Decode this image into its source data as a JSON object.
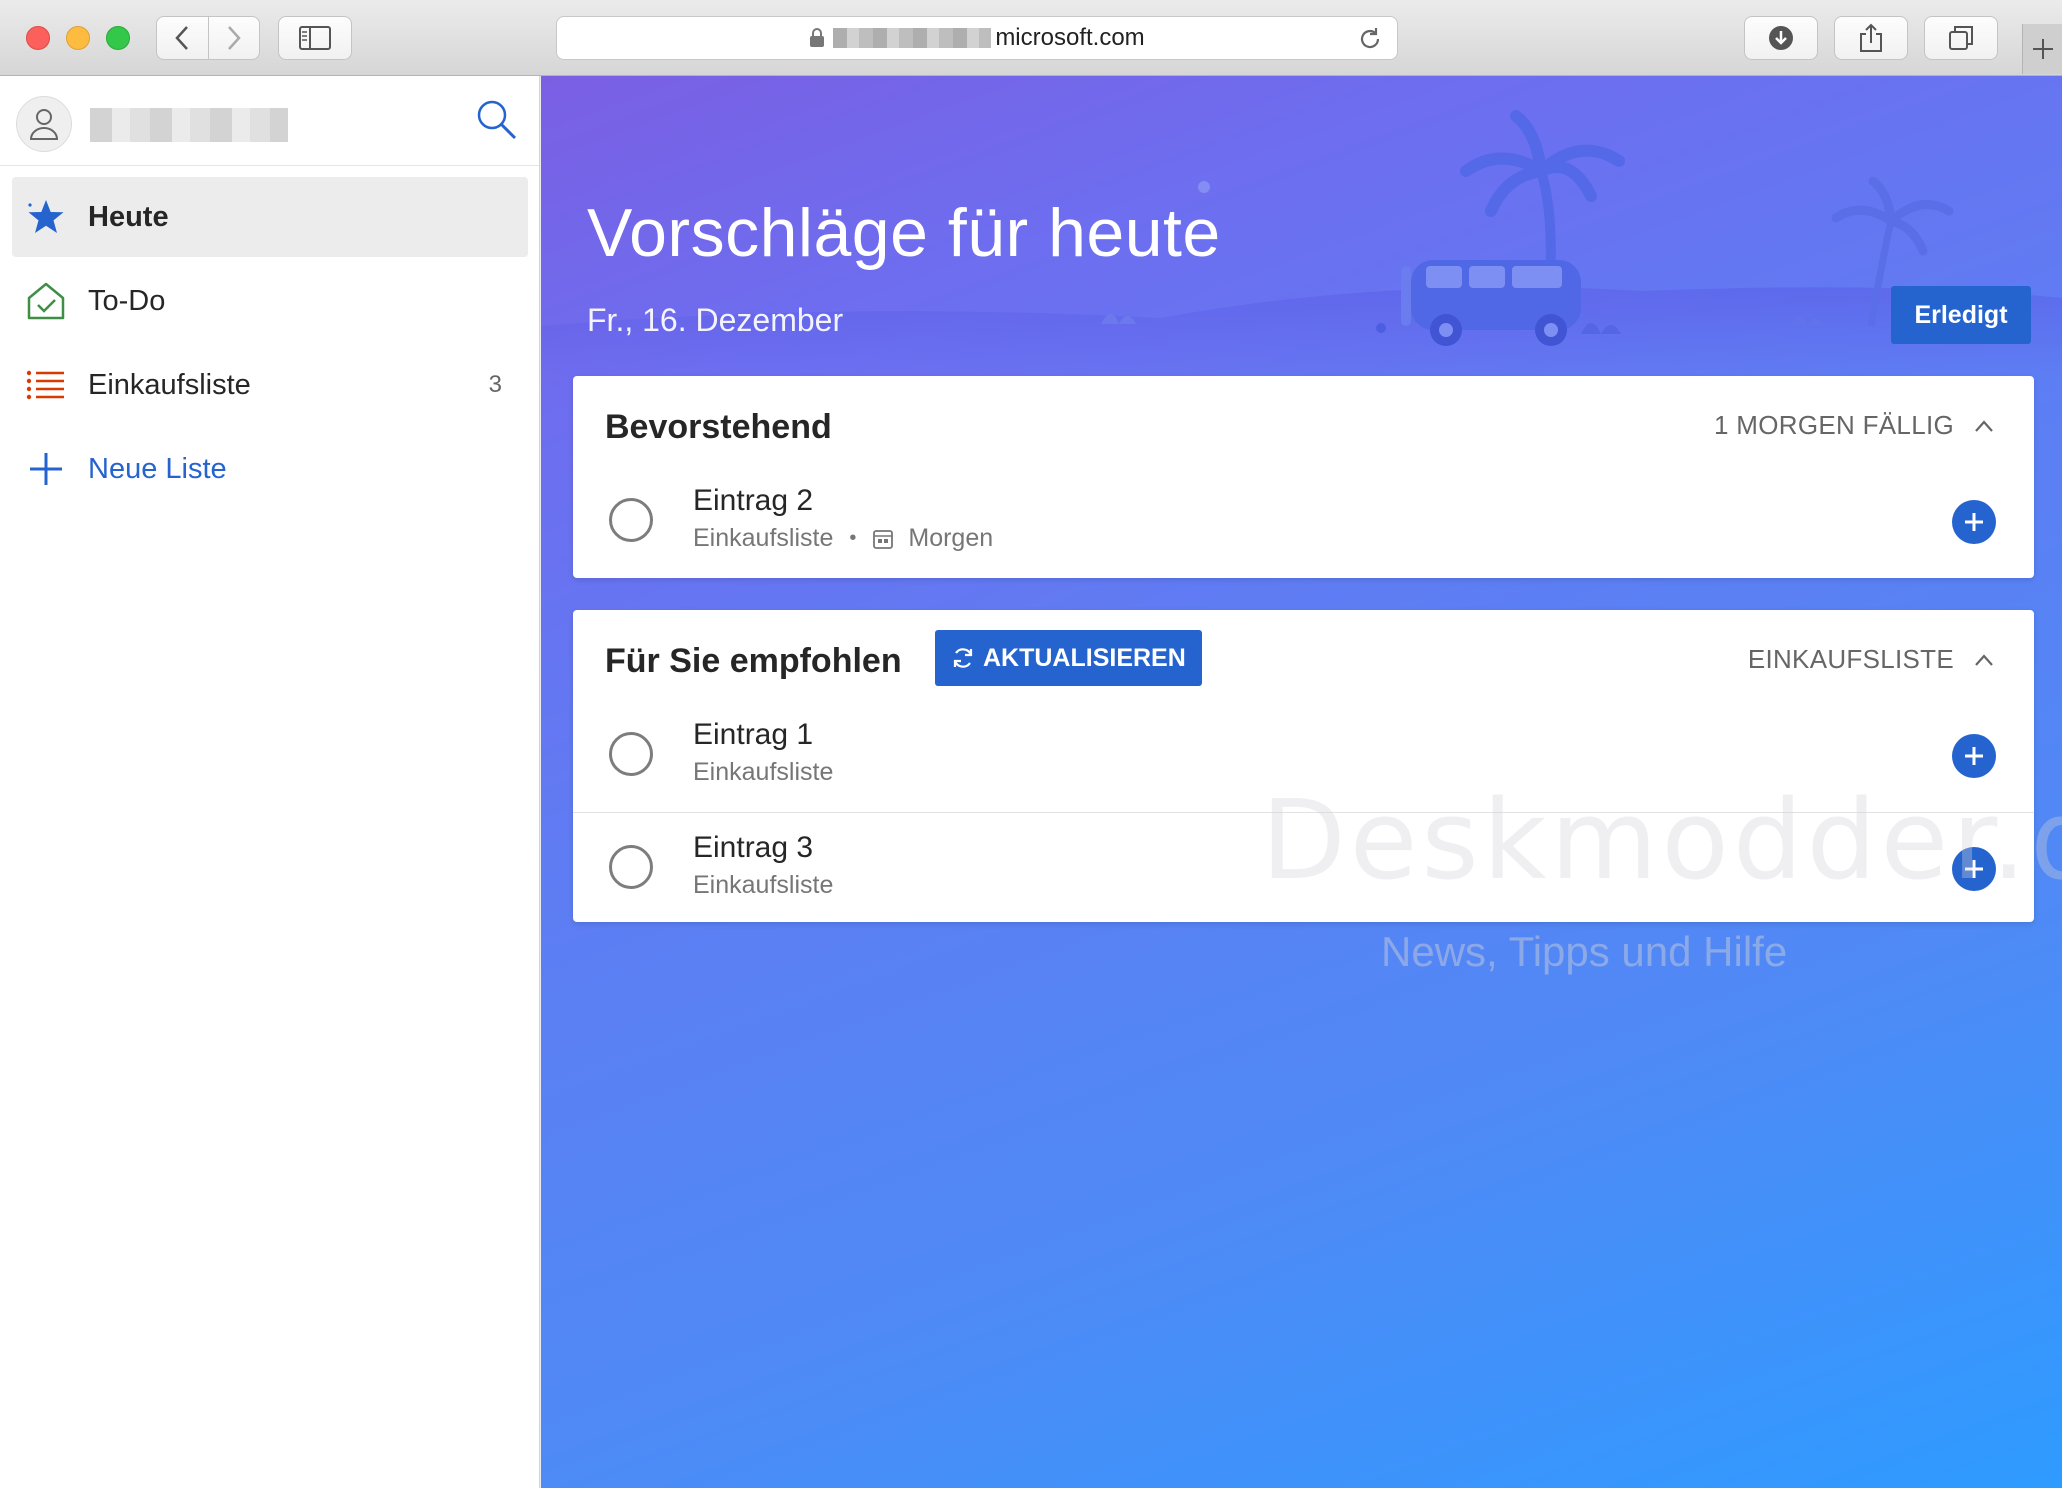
{
  "browser": {
    "url_domain": "microsoft.com"
  },
  "sidebar": {
    "items": [
      {
        "label": "Heute",
        "icon": "star-icon"
      },
      {
        "label": "To-Do",
        "icon": "home-check-icon"
      },
      {
        "label": "Einkaufsliste",
        "icon": "list-icon",
        "count": "3"
      },
      {
        "label": "Neue Liste",
        "icon": "plus-icon"
      }
    ]
  },
  "main": {
    "title": "Vorschläge für heute",
    "date": "Fr., 16. Dezember",
    "done_label": "Erledigt",
    "upcoming": {
      "heading": "Bevorstehend",
      "status": "1 MORGEN FÄLLIG",
      "tasks": [
        {
          "title": "Eintrag 2",
          "list": "Einkaufsliste",
          "due": "Morgen"
        }
      ]
    },
    "recommended": {
      "heading": "Für Sie empfohlen",
      "refresh_label": "AKTUALISIEREN",
      "filter": "EINKAUFSLISTE",
      "tasks": [
        {
          "title": "Eintrag 1",
          "list": "Einkaufsliste"
        },
        {
          "title": "Eintrag 3",
          "list": "Einkaufsliste"
        }
      ]
    }
  },
  "watermark": {
    "title": "Deskmodder.de",
    "subtitle": "News, Tipps und Hilfe"
  },
  "colors": {
    "accent": "#2564cf",
    "gradient_start": "#7a5fe3",
    "gradient_end": "#2e9bff",
    "list_icon": "#d83b01",
    "todo_icon": "#3f8e44"
  }
}
